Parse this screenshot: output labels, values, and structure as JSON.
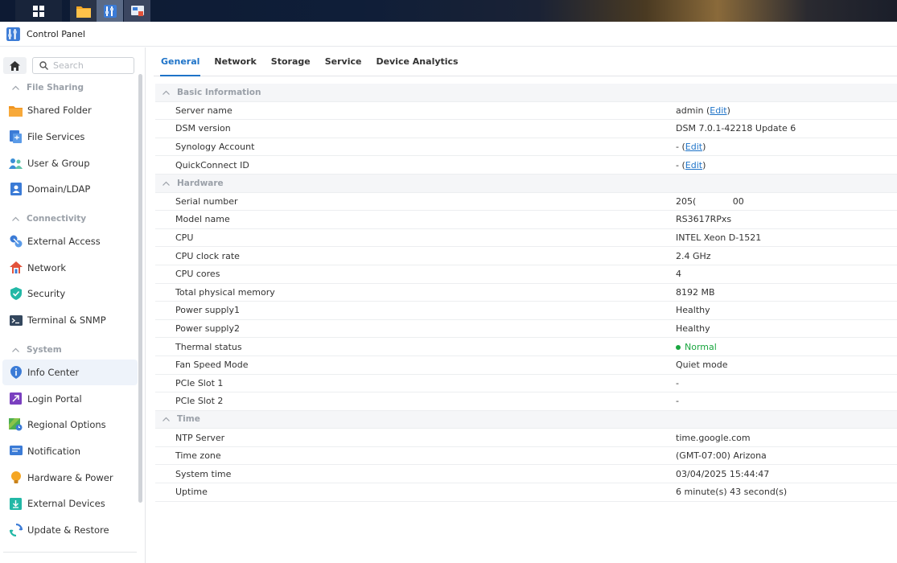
{
  "window": {
    "title": "Control Panel"
  },
  "search": {
    "placeholder": "Search"
  },
  "sidebar": {
    "groups": [
      {
        "label": "File Sharing",
        "items": [
          {
            "label": "Shared Folder",
            "icon": "folder-icon"
          },
          {
            "label": "File Services",
            "icon": "file-services-icon"
          },
          {
            "label": "User & Group",
            "icon": "users-icon"
          },
          {
            "label": "Domain/LDAP",
            "icon": "domain-icon"
          }
        ]
      },
      {
        "label": "Connectivity",
        "items": [
          {
            "label": "External Access",
            "icon": "external-access-icon"
          },
          {
            "label": "Network",
            "icon": "network-house-icon"
          },
          {
            "label": "Security",
            "icon": "shield-icon"
          },
          {
            "label": "Terminal & SNMP",
            "icon": "terminal-icon"
          }
        ]
      },
      {
        "label": "System",
        "items": [
          {
            "label": "Info Center",
            "icon": "info-icon",
            "active": true
          },
          {
            "label": "Login Portal",
            "icon": "login-portal-icon"
          },
          {
            "label": "Regional Options",
            "icon": "regional-icon"
          },
          {
            "label": "Notification",
            "icon": "notification-icon"
          },
          {
            "label": "Hardware & Power",
            "icon": "bulb-icon"
          },
          {
            "label": "External Devices",
            "icon": "external-devices-icon"
          },
          {
            "label": "Update & Restore",
            "icon": "update-icon"
          }
        ]
      }
    ]
  },
  "tabs": [
    {
      "label": "General",
      "active": true
    },
    {
      "label": "Network"
    },
    {
      "label": "Storage"
    },
    {
      "label": "Service"
    },
    {
      "label": "Device Analytics"
    }
  ],
  "info": {
    "edit_label": "Edit",
    "basic": {
      "title": "Basic Information",
      "server_name": {
        "label": "Server name",
        "value": "admin"
      },
      "dsm_version": {
        "label": "DSM version",
        "value": "DSM 7.0.1-42218 Update 6"
      },
      "synology_account": {
        "label": "Synology Account",
        "value": "-"
      },
      "quickconnect": {
        "label": "QuickConnect ID",
        "value": "-"
      }
    },
    "hardware": {
      "title": "Hardware",
      "rows": [
        {
          "label": "Serial number",
          "value": "205(             00"
        },
        {
          "label": "Model name",
          "value": "RS3617RPxs"
        },
        {
          "label": "CPU",
          "value": "INTEL Xeon D-1521"
        },
        {
          "label": "CPU clock rate",
          "value": "2.4 GHz"
        },
        {
          "label": "CPU cores",
          "value": "4"
        },
        {
          "label": "Total physical memory",
          "value": "8192 MB"
        },
        {
          "label": "Power supply1",
          "value": "Healthy"
        },
        {
          "label": "Power supply2",
          "value": "Healthy"
        },
        {
          "label": "Thermal status",
          "value": "Normal",
          "status_color": "#1aa640"
        },
        {
          "label": "Fan Speed Mode",
          "value": "Quiet mode"
        },
        {
          "label": "PCIe Slot 1",
          "value": "-"
        },
        {
          "label": "PCIe Slot 2",
          "value": "-"
        }
      ]
    },
    "time": {
      "title": "Time",
      "rows": [
        {
          "label": "NTP Server",
          "value": "time.google.com"
        },
        {
          "label": "Time zone",
          "value": "(GMT-07:00) Arizona"
        },
        {
          "label": "System time",
          "value": "03/04/2025 15:44:47"
        },
        {
          "label": "Uptime",
          "value": "6 minute(s) 43 second(s)"
        }
      ]
    }
  }
}
